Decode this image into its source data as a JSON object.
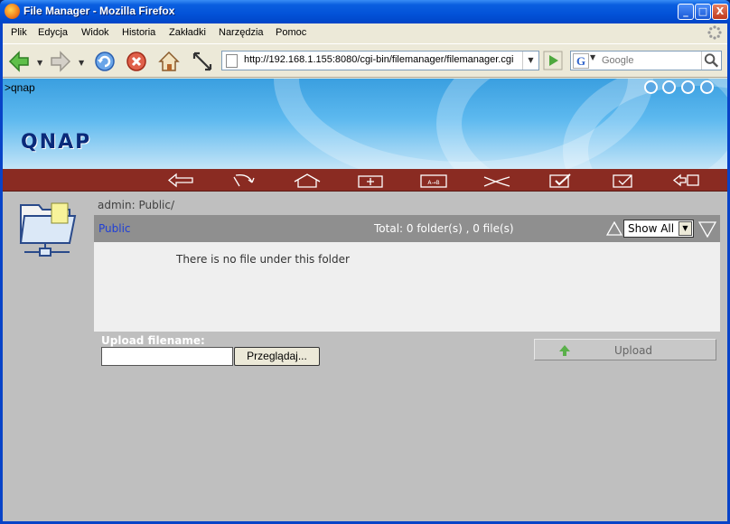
{
  "window": {
    "title": "File Manager - Mozilla Firefox",
    "min_label": "_",
    "max_label": "□",
    "close_label": "X"
  },
  "menu": {
    "items": [
      "Plik",
      "Edycja",
      "Widok",
      "Historia",
      "Zakładki",
      "Narzędzia",
      "Pomoc"
    ]
  },
  "navigation": {
    "url": "http://192.168.1.155:8080/cgi-bin/filemanager/filemanager.cgi",
    "search_placeholder": "Google",
    "search_engine_letter": "G"
  },
  "page": {
    "breadcrumb_top": ">qnap",
    "logo": "QNAP",
    "path_label": "admin: Public/",
    "folder_link": "Public",
    "total": "Total: 0 folder(s) , 0 file(s)",
    "filter_value": "Show All",
    "empty_message": "There is no file under this folder",
    "upload_label": "Upload filename:",
    "browse_label": "Przeglądaj...",
    "upload_button": "Upload"
  },
  "colors": {
    "banner_blue": "#3a9fe0",
    "toolbar_red": "#8a2b22",
    "list_header": "#8f8f8f",
    "link_blue": "#1f3fd6"
  },
  "icons": {
    "toolbar": [
      "back-arrow-icon",
      "refresh-icon",
      "home-icon",
      "new-folder-icon",
      "rename-icon",
      "cut-icon",
      "copy-icon",
      "paste-icon",
      "move-icon"
    ],
    "top_right": [
      "refresh-icon",
      "home-icon",
      "help-icon",
      "next-icon"
    ]
  }
}
